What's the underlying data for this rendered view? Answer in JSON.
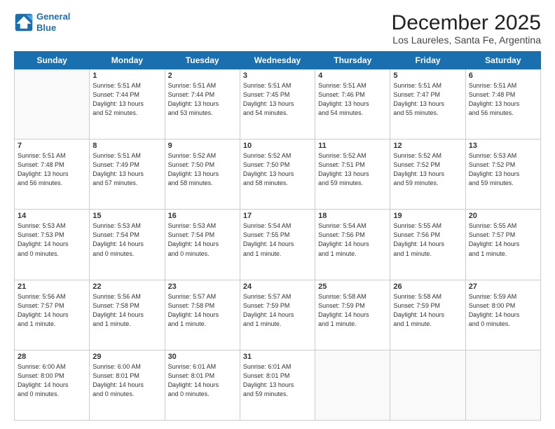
{
  "logo": {
    "line1": "General",
    "line2": "Blue"
  },
  "title": "December 2025",
  "subtitle": "Los Laureles, Santa Fe, Argentina",
  "weekdays": [
    "Sunday",
    "Monday",
    "Tuesday",
    "Wednesday",
    "Thursday",
    "Friday",
    "Saturday"
  ],
  "weeks": [
    [
      {
        "day": "",
        "info": ""
      },
      {
        "day": "1",
        "info": "Sunrise: 5:51 AM\nSunset: 7:44 PM\nDaylight: 13 hours\nand 52 minutes."
      },
      {
        "day": "2",
        "info": "Sunrise: 5:51 AM\nSunset: 7:44 PM\nDaylight: 13 hours\nand 53 minutes."
      },
      {
        "day": "3",
        "info": "Sunrise: 5:51 AM\nSunset: 7:45 PM\nDaylight: 13 hours\nand 54 minutes."
      },
      {
        "day": "4",
        "info": "Sunrise: 5:51 AM\nSunset: 7:46 PM\nDaylight: 13 hours\nand 54 minutes."
      },
      {
        "day": "5",
        "info": "Sunrise: 5:51 AM\nSunset: 7:47 PM\nDaylight: 13 hours\nand 55 minutes."
      },
      {
        "day": "6",
        "info": "Sunrise: 5:51 AM\nSunset: 7:48 PM\nDaylight: 13 hours\nand 56 minutes."
      }
    ],
    [
      {
        "day": "7",
        "info": "Sunrise: 5:51 AM\nSunset: 7:48 PM\nDaylight: 13 hours\nand 56 minutes."
      },
      {
        "day": "8",
        "info": "Sunrise: 5:51 AM\nSunset: 7:49 PM\nDaylight: 13 hours\nand 57 minutes."
      },
      {
        "day": "9",
        "info": "Sunrise: 5:52 AM\nSunset: 7:50 PM\nDaylight: 13 hours\nand 58 minutes."
      },
      {
        "day": "10",
        "info": "Sunrise: 5:52 AM\nSunset: 7:50 PM\nDaylight: 13 hours\nand 58 minutes."
      },
      {
        "day": "11",
        "info": "Sunrise: 5:52 AM\nSunset: 7:51 PM\nDaylight: 13 hours\nand 59 minutes."
      },
      {
        "day": "12",
        "info": "Sunrise: 5:52 AM\nSunset: 7:52 PM\nDaylight: 13 hours\nand 59 minutes."
      },
      {
        "day": "13",
        "info": "Sunrise: 5:53 AM\nSunset: 7:52 PM\nDaylight: 13 hours\nand 59 minutes."
      }
    ],
    [
      {
        "day": "14",
        "info": "Sunrise: 5:53 AM\nSunset: 7:53 PM\nDaylight: 14 hours\nand 0 minutes."
      },
      {
        "day": "15",
        "info": "Sunrise: 5:53 AM\nSunset: 7:54 PM\nDaylight: 14 hours\nand 0 minutes."
      },
      {
        "day": "16",
        "info": "Sunrise: 5:53 AM\nSunset: 7:54 PM\nDaylight: 14 hours\nand 0 minutes."
      },
      {
        "day": "17",
        "info": "Sunrise: 5:54 AM\nSunset: 7:55 PM\nDaylight: 14 hours\nand 1 minute."
      },
      {
        "day": "18",
        "info": "Sunrise: 5:54 AM\nSunset: 7:56 PM\nDaylight: 14 hours\nand 1 minute."
      },
      {
        "day": "19",
        "info": "Sunrise: 5:55 AM\nSunset: 7:56 PM\nDaylight: 14 hours\nand 1 minute."
      },
      {
        "day": "20",
        "info": "Sunrise: 5:55 AM\nSunset: 7:57 PM\nDaylight: 14 hours\nand 1 minute."
      }
    ],
    [
      {
        "day": "21",
        "info": "Sunrise: 5:56 AM\nSunset: 7:57 PM\nDaylight: 14 hours\nand 1 minute."
      },
      {
        "day": "22",
        "info": "Sunrise: 5:56 AM\nSunset: 7:58 PM\nDaylight: 14 hours\nand 1 minute."
      },
      {
        "day": "23",
        "info": "Sunrise: 5:57 AM\nSunset: 7:58 PM\nDaylight: 14 hours\nand 1 minute."
      },
      {
        "day": "24",
        "info": "Sunrise: 5:57 AM\nSunset: 7:59 PM\nDaylight: 14 hours\nand 1 minute."
      },
      {
        "day": "25",
        "info": "Sunrise: 5:58 AM\nSunset: 7:59 PM\nDaylight: 14 hours\nand 1 minute."
      },
      {
        "day": "26",
        "info": "Sunrise: 5:58 AM\nSunset: 7:59 PM\nDaylight: 14 hours\nand 1 minute."
      },
      {
        "day": "27",
        "info": "Sunrise: 5:59 AM\nSunset: 8:00 PM\nDaylight: 14 hours\nand 0 minutes."
      }
    ],
    [
      {
        "day": "28",
        "info": "Sunrise: 6:00 AM\nSunset: 8:00 PM\nDaylight: 14 hours\nand 0 minutes."
      },
      {
        "day": "29",
        "info": "Sunrise: 6:00 AM\nSunset: 8:01 PM\nDaylight: 14 hours\nand 0 minutes."
      },
      {
        "day": "30",
        "info": "Sunrise: 6:01 AM\nSunset: 8:01 PM\nDaylight: 14 hours\nand 0 minutes."
      },
      {
        "day": "31",
        "info": "Sunrise: 6:01 AM\nSunset: 8:01 PM\nDaylight: 13 hours\nand 59 minutes."
      },
      {
        "day": "",
        "info": ""
      },
      {
        "day": "",
        "info": ""
      },
      {
        "day": "",
        "info": ""
      }
    ]
  ]
}
